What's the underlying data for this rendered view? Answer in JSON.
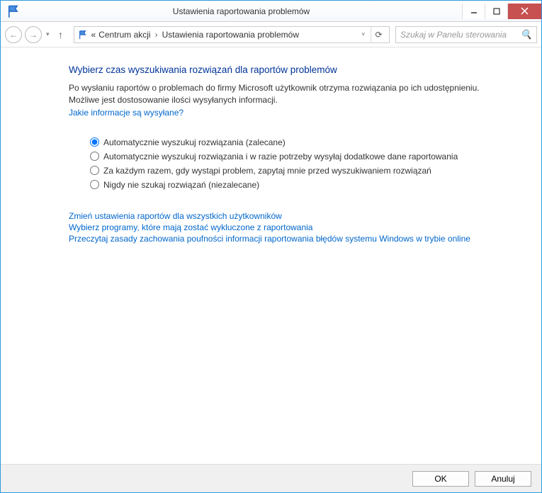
{
  "window": {
    "title": "Ustawienia raportowania problemów"
  },
  "breadcrumb": {
    "prefix": "«",
    "item1": "Centrum akcji",
    "item2": "Ustawienia raportowania problemów"
  },
  "search": {
    "placeholder": "Szukaj w Panelu sterowania"
  },
  "main": {
    "heading": "Wybierz czas wyszukiwania rozwiązań dla raportów problemów",
    "description": "Po wysłaniu raportów o problemach do firmy Microsoft użytkownik otrzyma rozwiązania po ich udostępnieniu. Możliwe jest dostosowanie ilości wysyłanych informacji.",
    "info_link": "Jakie informacje są wysyłane?"
  },
  "radios": {
    "opt1": "Automatycznie wyszukuj rozwiązania (zalecane)",
    "opt2": "Automatycznie wyszukuj rozwiązania i w razie potrzeby wysyłaj dodatkowe dane raportowania",
    "opt3": "Za każdym razem, gdy wystąpi problem, zapytaj mnie przed wyszukiwaniem rozwiązań",
    "opt4": "Nigdy nie szukaj rozwiązań (niezalecane)",
    "selected": "opt1"
  },
  "links": {
    "l1": "Zmień ustawienia raportów dla wszystkich użytkowników",
    "l2": "Wybierz programy, które mają zostać wykluczone z raportowania",
    "l3": "Przeczytaj zasady zachowania poufności informacji raportowania błędów systemu Windows w trybie online"
  },
  "footer": {
    "ok": "OK",
    "cancel": "Anuluj"
  }
}
